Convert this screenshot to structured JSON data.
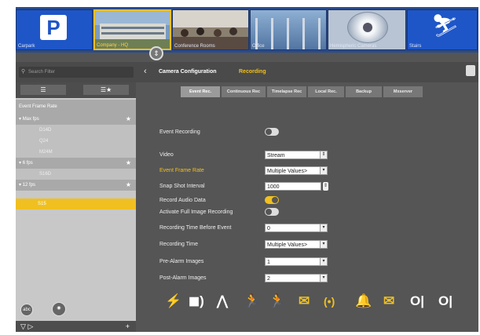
{
  "cameras": [
    {
      "label": "Carpark",
      "scene": "parking-sign",
      "bg": "#1e56c8",
      "active": false
    },
    {
      "label": "Company - HQ",
      "scene": "building",
      "bg": "#7a9bc0",
      "active": true
    },
    {
      "label": "Conference Rooms",
      "scene": "meeting-room",
      "bg": "#8a8070",
      "active": false
    },
    {
      "label": "Office",
      "scene": "office",
      "bg": "#6b8fb6",
      "active": false
    },
    {
      "label": "Hemispheric Cameras",
      "scene": "dome-camera",
      "bg": "#b8c4d4",
      "active": false
    },
    {
      "label": "Stairs",
      "scene": "stairs-sign",
      "bg": "#1e56c8",
      "active": false
    }
  ],
  "header": {
    "search_placeholder": "Search Filter",
    "title": "Camera Configuration",
    "subtitle": "Recording"
  },
  "left_panel": {
    "tree_header": "Event Frame Rate",
    "groups": [
      {
        "label": "Max fps",
        "items": [
          "D14D",
          "Q24",
          "M24M"
        ]
      },
      {
        "label": "6 fps",
        "items": [
          "S16D"
        ]
      },
      {
        "label": "12 fps",
        "items": []
      }
    ],
    "selected_item": "S15"
  },
  "tabs": [
    {
      "label": "Event Rec.",
      "active": true
    },
    {
      "label": "Continuous Rec",
      "active": false
    },
    {
      "label": "Timelapse Rec",
      "active": false
    },
    {
      "label": "Local Rec.",
      "active": false
    },
    {
      "label": "Backup",
      "active": false
    },
    {
      "label": "Mxserver",
      "active": false
    }
  ],
  "form": {
    "event_recording_label": "Event Recording",
    "video_label": "Video",
    "video_value": "Stream",
    "event_frame_rate_label": "Event Frame Rate",
    "event_frame_rate_value": "Multiple Values>",
    "snap_shot_label": "Snap Shot Interval",
    "snap_shot_value": "1000",
    "record_audio_label": "Record Audio Data",
    "full_image_label": "Activate Full Image Recording",
    "time_before_label": "Recording Time Before Event",
    "time_before_value": "0",
    "recording_time_label": "Recording Time",
    "recording_time_value": "Multiple Values>",
    "pre_alarm_label": "Pre-Alarm Images",
    "pre_alarm_value": "1",
    "post_alarm_label": "Post-Alarm Images",
    "post_alarm_value": "2"
  },
  "event_icons": [
    "wand-icon",
    "camera-sensor-icon",
    "signal-icon",
    "running-person-icon",
    "running-person-outline-icon",
    "envelope-icon",
    "broadcast-icon",
    "bell-icon",
    "envelope-icon",
    "input-signal-icon",
    "input-signal-icon"
  ],
  "colors": {
    "accent": "#f0c020",
    "topbar": "#2a4a8c",
    "panel": "#555555"
  }
}
